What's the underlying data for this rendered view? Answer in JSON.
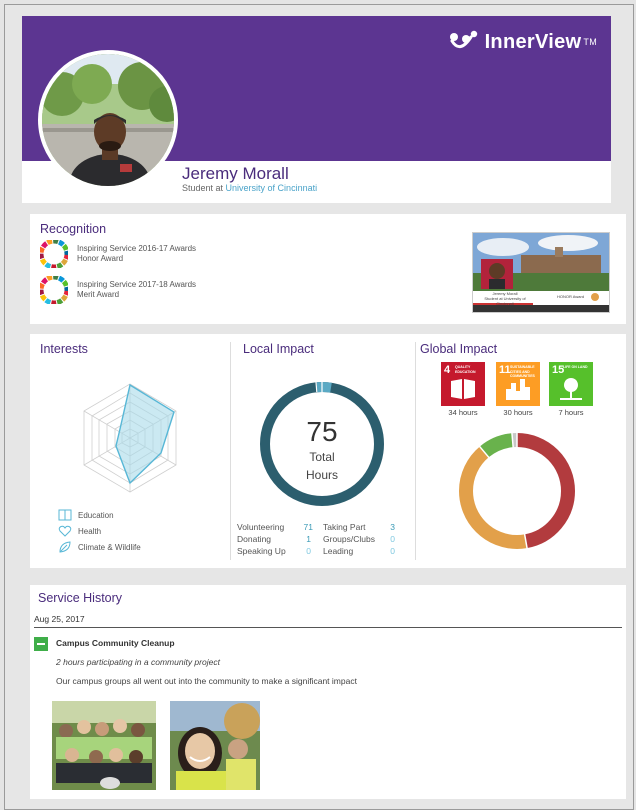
{
  "brand": {
    "name": "InnerView",
    "tm": "TM"
  },
  "profile": {
    "name": "Jeremy Morall",
    "role_prefix": "Student at ",
    "school": "University of Cincinnati"
  },
  "recognition": {
    "title": "Recognition",
    "awards": [
      {
        "line1": "Inspiring Service 2016-17 Awards",
        "line2": "Honor Award"
      },
      {
        "line1": "Inspiring Service 2017-18 Awards",
        "line2": "Merit Award"
      }
    ],
    "video": {
      "caption_name": "Jeremy Morall",
      "caption_sub": "Student at University of Cincinnati",
      "badge": "HONOR Award"
    }
  },
  "interests": {
    "title": "Interests",
    "items": [
      {
        "label": "Education",
        "icon": "book-icon"
      },
      {
        "label": "Health",
        "icon": "heart-icon"
      },
      {
        "label": "Climate & Wildlife",
        "icon": "leaf-icon"
      }
    ]
  },
  "local_impact": {
    "title": "Local Impact",
    "total_value": "75",
    "total_label_1": "Total",
    "total_label_2": "Hours",
    "stats_left": [
      {
        "label": "Volunteering",
        "value": "71"
      },
      {
        "label": "Donating",
        "value": "1"
      },
      {
        "label": "Speaking Up",
        "value": "0"
      }
    ],
    "stats_right": [
      {
        "label": "Taking Part",
        "value": "3"
      },
      {
        "label": "Groups/Clubs",
        "value": "0"
      },
      {
        "label": "Leading",
        "value": "0"
      }
    ],
    "colors": {
      "main": "#2c5e6e",
      "accent": "#5aa9c4"
    }
  },
  "global_impact": {
    "title": "Global Impact",
    "goals": [
      {
        "number": "4",
        "name": "QUALITY EDUCATION",
        "hours": "34 hours",
        "color": "#c5192d",
        "icon": "open-book-icon"
      },
      {
        "number": "11",
        "name": "SUSTAINABLE CITIES AND COMMUNITIES",
        "hours": "30 hours",
        "color": "#fd9d24",
        "icon": "city-icon"
      },
      {
        "number": "15",
        "name": "LIFE ON LAND",
        "hours": "7 hours",
        "color": "#56c02b",
        "icon": "tree-icon"
      }
    ],
    "donut": [
      {
        "name": "QUALITY EDUCATION",
        "value": 34,
        "color": "#b23b3e"
      },
      {
        "name": "SUSTAINABLE CITIES AND COMMUNITIES",
        "value": 30,
        "color": "#e2a04a"
      },
      {
        "name": "LIFE ON LAND",
        "value": 7,
        "color": "#69b24c"
      },
      {
        "name": "other",
        "value": 1,
        "color": "#c8c8c8"
      }
    ]
  },
  "service_history": {
    "title": "Service History",
    "date": "Aug 25, 2017",
    "entry": {
      "title": "Campus Community Cleanup",
      "subtitle": "2 hours participating in a community project",
      "description": "Our campus groups all went out into the community to make a significant impact"
    }
  }
}
